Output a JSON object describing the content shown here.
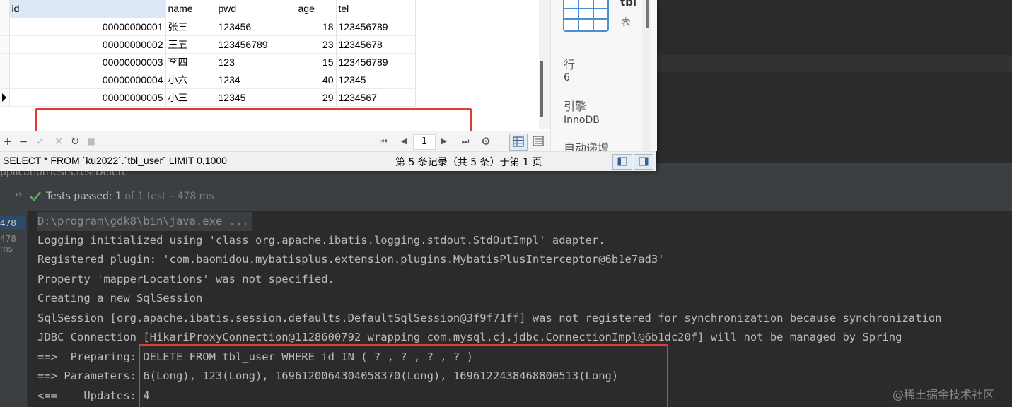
{
  "table": {
    "columns": [
      "id",
      "name",
      "pwd",
      "age",
      "tel"
    ],
    "rows": [
      {
        "id": "00000000001",
        "name": "张三",
        "pwd": "123456",
        "age": "18",
        "tel": "123456789"
      },
      {
        "id": "00000000002",
        "name": "王五",
        "pwd": "123456789",
        "age": "23",
        "tel": "12345678"
      },
      {
        "id": "00000000003",
        "name": "李四",
        "pwd": "123",
        "age": "15",
        "tel": "123456789"
      },
      {
        "id": "00000000004",
        "name": "小六",
        "pwd": "1234",
        "age": "40",
        "tel": "12345"
      },
      {
        "id": "00000000005",
        "name": "小三",
        "pwd": "12345",
        "age": "29",
        "tel": "1234567"
      }
    ]
  },
  "toolbar": {
    "add": "+",
    "remove": "−",
    "apply": "✓",
    "discard": "✕",
    "refresh": "↻",
    "stop": "■",
    "first": "⏮",
    "prev": "◀",
    "page": "1",
    "next": "▶",
    "last": "⏭",
    "settings": "⚙"
  },
  "status": {
    "sql": "SELECT * FROM `ku2022`.`tbl_user` LIMIT 0,1000",
    "record": "第 5 条记录（共 5 条）于第 1 页"
  },
  "info": {
    "title": "tbl",
    "subtitle": "表",
    "rows_label": "行",
    "rows_value": "6",
    "engine_label": "引擎",
    "engine_value": "InnoDB",
    "autoinc_label": "自动递增"
  },
  "ide": {
    "tab_label": "pplicationTests.testDelete",
    "tests_passed": "Tests passed:",
    "tests_count": "1",
    "tests_detail": "of 1 test – 478 ms",
    "durations": [
      "478 ms",
      "478 ms"
    ]
  },
  "console": {
    "command": "D:\\program\\gdk8\\bin\\java.exe ...",
    "lines": [
      "Logging initialized using 'class org.apache.ibatis.logging.stdout.StdOutImpl' adapter.",
      "Registered plugin: 'com.baomidou.mybatisplus.extension.plugins.MybatisPlusInterceptor@6b1e7ad3'",
      "Property 'mapperLocations' was not specified.",
      "Creating a new SqlSession",
      "SqlSession [org.apache.ibatis.session.defaults.DefaultSqlSession@3f9f71ff] was not registered for synchronization because synchronization",
      "JDBC Connection [HikariProxyConnection@1128600792 wrapping com.mysql.cj.jdbc.ConnectionImpl@6b1dc20f] will not be managed by Spring",
      "==>  Preparing: DELETE FROM tbl_user WHERE id IN ( ? , ? , ? , ? )",
      "==> Parameters: 6(Long), 123(Long), 1696120064304058370(Long), 1696122438468800513(Long)",
      "<==    Updates: 4"
    ]
  },
  "watermark": "@稀土掘金技术社区",
  "colors": {
    "annotation": "#e53935",
    "pass_green": "#5fb760",
    "console_bg": "#2b2b2b"
  }
}
